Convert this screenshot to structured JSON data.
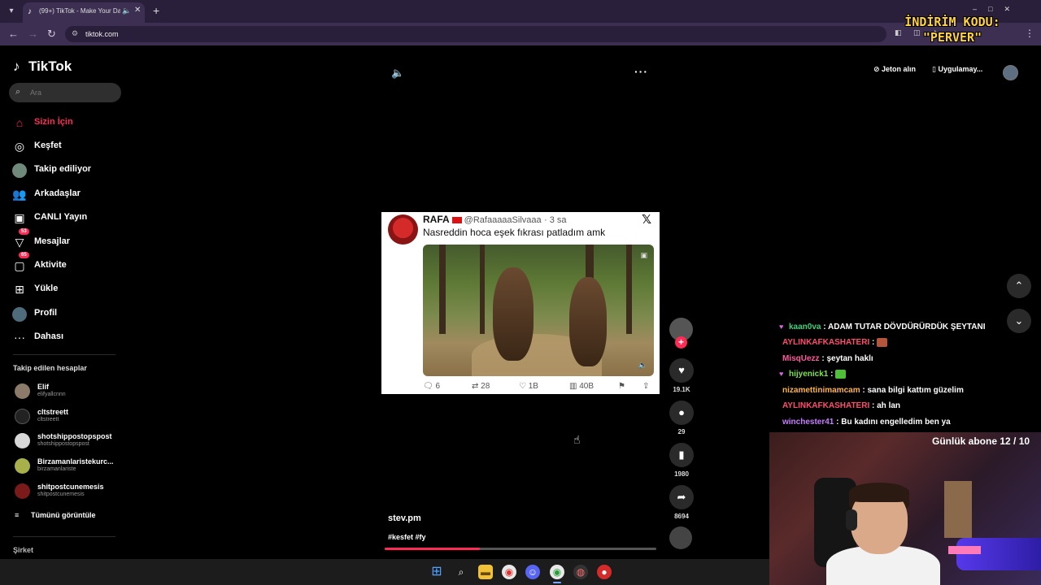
{
  "browser": {
    "tab_title": "(99+) TikTok - Make Your Da",
    "url": "tiktok.com",
    "new_tab": "+",
    "tab_close": "✕"
  },
  "promo_overlay": {
    "line1": "İNDİRİM KODU:",
    "line2": "\"PERVER\""
  },
  "tiktok": {
    "logo": "TikTok",
    "search_placeholder": "Ara",
    "nav": [
      {
        "label": "Sizin İçin",
        "icon": "home-icon",
        "active": true
      },
      {
        "label": "Keşfet",
        "icon": "compass-icon"
      },
      {
        "label": "Takip ediliyor",
        "icon": "following-avatar-icon"
      },
      {
        "label": "Arkadaşlar",
        "icon": "friends-icon"
      },
      {
        "label": "CANLI Yayın",
        "icon": "live-tv-icon"
      },
      {
        "label": "Mesajlar",
        "icon": "inbox-icon",
        "badge": "53"
      },
      {
        "label": "Aktivite",
        "icon": "activity-icon",
        "badge": "65"
      },
      {
        "label": "Yükle",
        "icon": "upload-icon"
      },
      {
        "label": "Profil",
        "icon": "profile-avatar-icon"
      },
      {
        "label": "Dahası",
        "icon": "more-dots-icon"
      }
    ],
    "following_title": "Takip edilen hesaplar",
    "following": [
      {
        "name": "Elif",
        "handle": "elifyallcnnn",
        "color": "#8c7a6a"
      },
      {
        "name": "cltstreett",
        "handle": "cltstreett",
        "color": "#222222"
      },
      {
        "name": "shotshippostopspost",
        "handle": "shotshippostopspost",
        "color": "#d8d8d8"
      },
      {
        "name": "Birzamanlaristekurc...",
        "handle": "birzamanlariste",
        "color": "#a8b04a"
      },
      {
        "name": "shitpostcunemesis",
        "handle": "shitpostcunemesis",
        "color": "#7a1a1a"
      }
    ],
    "see_all": "Tümünü görüntüle",
    "company": "Şirket",
    "header": {
      "coins": "Jeton alın",
      "app": "Uygulamay..."
    },
    "video": {
      "author": "stev.pm",
      "hashtags": "#kesfet #fy",
      "progress": 0.35,
      "actions": {
        "likes": "19.1K",
        "comments": "29",
        "saves": "1980",
        "shares": "8694"
      }
    },
    "tweet": {
      "name": "RAFA",
      "handle": "@RafaaaaaSilvaaa",
      "time": "· 3 sa",
      "text": "Nasreddin hoca eşek fıkrası patladım amk",
      "replies": "6",
      "retweets": "28",
      "likes": "1B",
      "views": "40B"
    }
  },
  "stream": {
    "chat": [
      {
        "user": "kaan0va",
        "color": "#3fd07a",
        "msg": "ADAM TUTAR DÖVDÜRÜRDÜK ŞEYTANI",
        "heart": true
      },
      {
        "user": "AYLINKAFKASHATERI",
        "color": "#ff4d6d",
        "msg": "",
        "emote": "#b5563a"
      },
      {
        "user": "MisqUezz",
        "color": "#ff5a9e",
        "msg": "şeytan haklı"
      },
      {
        "user": "hijyenick1",
        "color": "#7fe34a",
        "msg": "",
        "heart": true,
        "emote": "#4fbf3a"
      },
      {
        "user": "nizamettinimamcam",
        "color": "#ffb347",
        "msg": "sana bilgi kattım güzelim"
      },
      {
        "user": "AYLINKAFKASHATERI",
        "color": "#ff4d6d",
        "msg": "ah lan"
      },
      {
        "user": "winchester41",
        "color": "#c77dff",
        "msg": "Bu kadını engelledim ben ya"
      }
    ],
    "sub_goal": "Günlük abone 12 / 10"
  }
}
